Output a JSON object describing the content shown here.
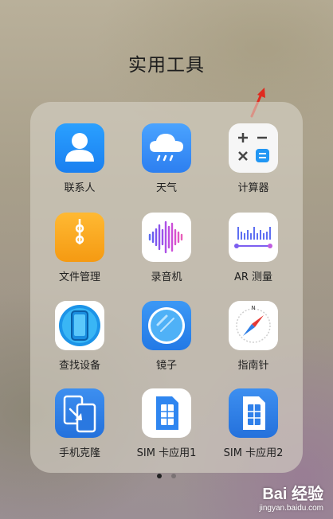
{
  "folder": {
    "title": "实用工具"
  },
  "apps": [
    {
      "label": "联系人",
      "icon": "contacts-icon",
      "color": "#1e8cf0"
    },
    {
      "label": "天气",
      "icon": "weather-icon",
      "color": "#3a8ef5"
    },
    {
      "label": "计算器",
      "icon": "calculator-icon",
      "color": "#f4f4f4"
    },
    {
      "label": "文件管理",
      "icon": "file-manager-icon",
      "color": "#f5a623"
    },
    {
      "label": "录音机",
      "icon": "recorder-icon",
      "color": "#ffffff"
    },
    {
      "label": "AR 测量",
      "icon": "ar-measure-icon",
      "color": "#ffffff"
    },
    {
      "label": "查找设备",
      "icon": "find-device-icon",
      "color": "#ffffff"
    },
    {
      "label": "镜子",
      "icon": "mirror-icon",
      "color": "#2b86f0"
    },
    {
      "label": "指南针",
      "icon": "compass-icon",
      "color": "#ffffff"
    },
    {
      "label": "手机克隆",
      "icon": "phone-clone-icon",
      "color": "#2f7fe6"
    },
    {
      "label": "SIM 卡应用1",
      "icon": "sim-card-icon",
      "color": "#ffffff"
    },
    {
      "label": "SIM 卡应用2",
      "icon": "sim-card-icon",
      "color": "#2f7fe6"
    }
  ],
  "pager": {
    "pages": 2,
    "current": 1
  },
  "watermark": {
    "brand": "Bai 经验",
    "url": "jingyan.baidu.com"
  }
}
